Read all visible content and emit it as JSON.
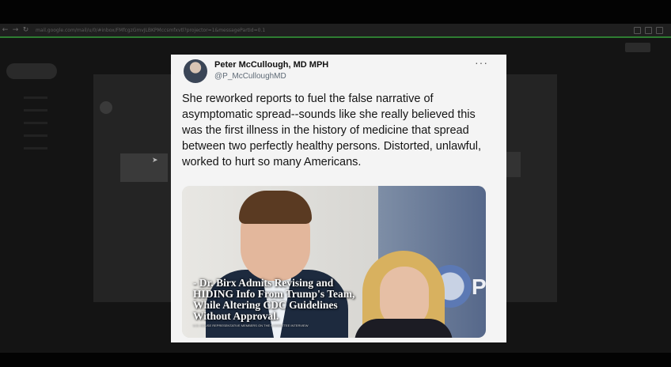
{
  "browser": {
    "url": "mail.google.com/mail/u/0/#inbox/FMfcgzGmvJLBKPMccsmfxvtl?projector=1&messagePartId=0.1",
    "toolbar_icons": [
      "back-arrow",
      "forward-arrow",
      "reload"
    ]
  },
  "tweet": {
    "author_name": "Peter McCullough, MD MPH",
    "author_handle": "@P_McCulloughMD",
    "more_label": "···",
    "text": "She reworked reports to fuel the false narrative of asymptomatic spread--sounds like she really believed this was the first illness in the history of medicine that spread between two perfectly healthy persons. Distorted, unlawful, worked to hurt so many Americans.",
    "media": {
      "caption": "- Dr. Birx Admits Revising and HIDING Info From Trump's Team, While Altering CDC Guidelines Without Approval.",
      "subcaption": "U.S. HOUSE REPRESENTATIVE MEMBERS ON THE COMMITTEE INTERVIEW",
      "banner_letter": "P"
    }
  },
  "colors": {
    "background": "#050505",
    "card": "#f4f4f4",
    "text": "#141414",
    "handle": "#5e6a76",
    "toolbar_accent": "#2e7d32"
  }
}
